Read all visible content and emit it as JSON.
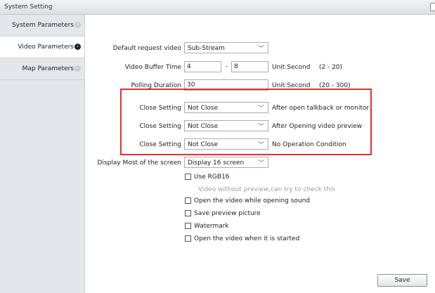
{
  "window": {
    "title": "System Setting"
  },
  "sidebar": {
    "items": [
      {
        "label": "System Parameters",
        "active": false
      },
      {
        "label": "Video Parameters",
        "active": true
      },
      {
        "label": "Map Parameters",
        "active": false
      }
    ]
  },
  "settings": {
    "default_request_video": {
      "label": "Default request video",
      "value": "Sub-Stream"
    },
    "video_buffer_time": {
      "label": "Video Buffer Time",
      "from": "4",
      "dash": "-",
      "to": "8",
      "unit": "Unit:Second",
      "range": "(2 - 20)"
    },
    "polling_duration": {
      "label": "Polling Duration",
      "value": "30",
      "unit": "Unit:Second",
      "range": "(20 - 300)"
    },
    "close_settings": [
      {
        "label": "Close Setting",
        "value": "Not Close",
        "desc": "After open talkback or monitor"
      },
      {
        "label": "Close Setting",
        "value": "Not Close",
        "desc": "After Opening video preview"
      },
      {
        "label": "Close Setting",
        "value": "Not Close",
        "desc": "No Operation Condition"
      }
    ],
    "display_most": {
      "label": "Display Most of the screen",
      "value": "Display 16 screen"
    },
    "use_rgb16": {
      "label": "Use RGB16",
      "checked": false,
      "hint": "Video without preview,can try to check this"
    },
    "options": [
      {
        "label": "Open the video while opening sound",
        "checked": false
      },
      {
        "label": "Save preview picture",
        "checked": false
      },
      {
        "label": "Watermark",
        "checked": false
      },
      {
        "label": "Open the video when it is started",
        "checked": false
      }
    ]
  },
  "buttons": {
    "save": "Save"
  },
  "colors": {
    "highlight_border": "#e0322f",
    "sidebar_bg": "#e3e7ec"
  }
}
